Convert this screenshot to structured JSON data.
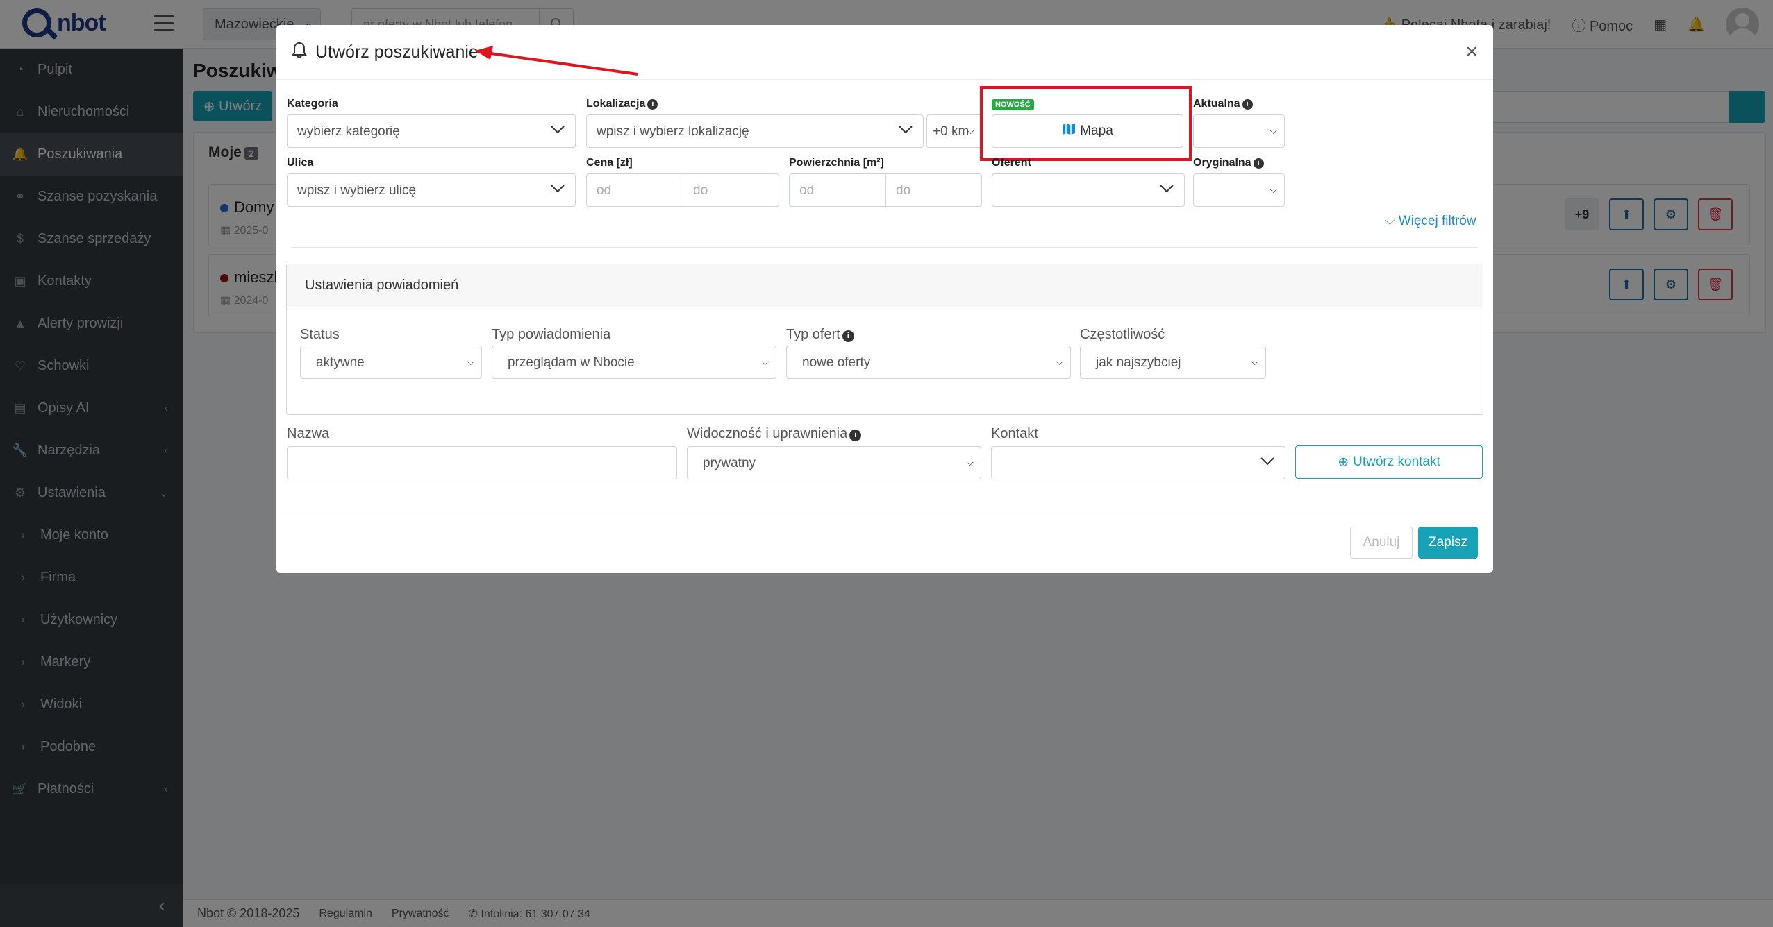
{
  "app": {
    "logo_text": "nbot"
  },
  "topbar": {
    "region": "Mazowieckie",
    "search_placeholder": "nr oferty w Nbot lub telefon",
    "refer_label": "Polecaj Nbota i zarabiaj!",
    "help_label": "Pomoc"
  },
  "sidebar": {
    "items": [
      {
        "label": "Pulpit",
        "icon": "dashboard-icon"
      },
      {
        "label": "Nieruchomości",
        "icon": "home-icon"
      },
      {
        "label": "Poszukiwania",
        "icon": "bell-icon",
        "active": true
      },
      {
        "label": "Szanse pozyskania",
        "icon": "handshake-icon"
      },
      {
        "label": "Szanse sprzedaży",
        "icon": "dollar-icon"
      },
      {
        "label": "Kontakty",
        "icon": "contact-icon"
      },
      {
        "label": "Alerty prowizji",
        "icon": "warning-icon"
      },
      {
        "label": "Schowki",
        "icon": "heart-icon"
      },
      {
        "label": "Opisy AI",
        "icon": "chat-icon"
      },
      {
        "label": "Narzędzia",
        "icon": "wrench-icon"
      },
      {
        "label": "Ustawienia",
        "icon": "gear-icon"
      },
      {
        "label": "Moje konto",
        "icon": "caret-right-icon"
      },
      {
        "label": "Firma",
        "icon": "caret-right-icon"
      },
      {
        "label": "Użytkownicy",
        "icon": "caret-right-icon"
      },
      {
        "label": "Markery",
        "icon": "caret-right-icon"
      },
      {
        "label": "Widoki",
        "icon": "caret-right-icon"
      },
      {
        "label": "Podobne",
        "icon": "caret-right-icon"
      },
      {
        "label": "Płatności",
        "icon": "cart-icon"
      }
    ]
  },
  "page": {
    "title": "Poszukiwa",
    "create_label": "Utwórz",
    "tab_label": "Moje",
    "tab_count": "2",
    "rows": [
      {
        "name": "Domy",
        "date": "2025-0",
        "dot_color": "#1e6fd9",
        "extra": "+9"
      },
      {
        "name": "mieszk",
        "date": "2024-0",
        "dot_color": "#a50e0e",
        "extra": ""
      }
    ]
  },
  "footer": {
    "copyright": "Nbot © 2018-2025",
    "terms": "Regulamin",
    "privacy": "Prywatność",
    "hotline": "Infolinia: 61 307 07 34"
  },
  "modal": {
    "title": "Utwórz poszukiwanie",
    "kategoria": {
      "label": "Kategoria",
      "placeholder": "wybierz kategorię"
    },
    "lokalizacja": {
      "label": "Lokalizacja",
      "placeholder": "wpisz i wybierz lokalizację",
      "radius": "+0 km"
    },
    "mapa": {
      "badge": "NOWOŚĆ",
      "label": "Mapa"
    },
    "aktualna": {
      "label": "Aktualna"
    },
    "ulica": {
      "label": "Ulica",
      "placeholder": "wpisz i wybierz ulicę"
    },
    "cena": {
      "label": "Cena [zł]",
      "from": "od",
      "to": "do"
    },
    "powierzchnia": {
      "label": "Powierzchnia [m²]",
      "from": "od",
      "to": "do"
    },
    "oferent": {
      "label": "Oferent"
    },
    "oryginalna": {
      "label": "Oryginalna"
    },
    "more_filters": "Więcej filtrów",
    "notifications": {
      "title": "Ustawienia powiadomień",
      "status": {
        "label": "Status",
        "value": "aktywne"
      },
      "typ_powiadomienia": {
        "label": "Typ powiadomienia",
        "value": "przeglądam w Nbocie"
      },
      "typ_ofert": {
        "label": "Typ ofert",
        "value": "nowe oferty"
      },
      "czestotliwosc": {
        "label": "Częstotliwość",
        "value": "jak najszybciej"
      }
    },
    "nazwa": {
      "label": "Nazwa",
      "value": ""
    },
    "widocznosc": {
      "label": "Widoczność i uprawnienia",
      "value": "prywatny"
    },
    "kontakt": {
      "label": "Kontakt",
      "value": ""
    },
    "create_contact": "Utwórz kontakt",
    "cancel": "Anuluj",
    "save": "Zapisz"
  },
  "colors": {
    "accent": "#17a2b8",
    "highlight": "#e0141e",
    "sidebar": "#343a40"
  }
}
